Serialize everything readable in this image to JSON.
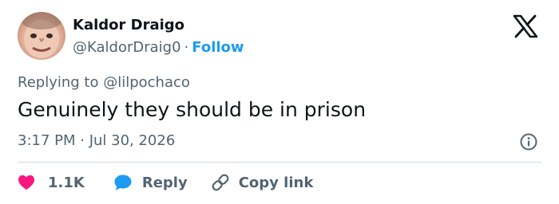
{
  "author": {
    "name": "Kaldor Draigo",
    "handle": "@KaldorDraig0",
    "separator": "·",
    "follow_label": "Follow"
  },
  "reply_context": {
    "prefix": "Replying to",
    "mention": "@lilpochaco"
  },
  "tweet": {
    "text": "Genuinely they should be in prison",
    "timestamp": "3:17 PM · Jul 30, 2026"
  },
  "actions": {
    "likes": "1.1K",
    "reply_label": "Reply",
    "copy_link_label": "Copy link"
  },
  "icons": {
    "brand": "x-logo-icon",
    "info": "info-icon",
    "like": "heart-icon",
    "reply": "speech-bubble-icon",
    "copy": "link-icon"
  },
  "colors": {
    "text": "#0f1419",
    "secondary": "#536471",
    "accent": "#1d9bf0",
    "like": "#f91880",
    "divider": "#cfd9de"
  }
}
